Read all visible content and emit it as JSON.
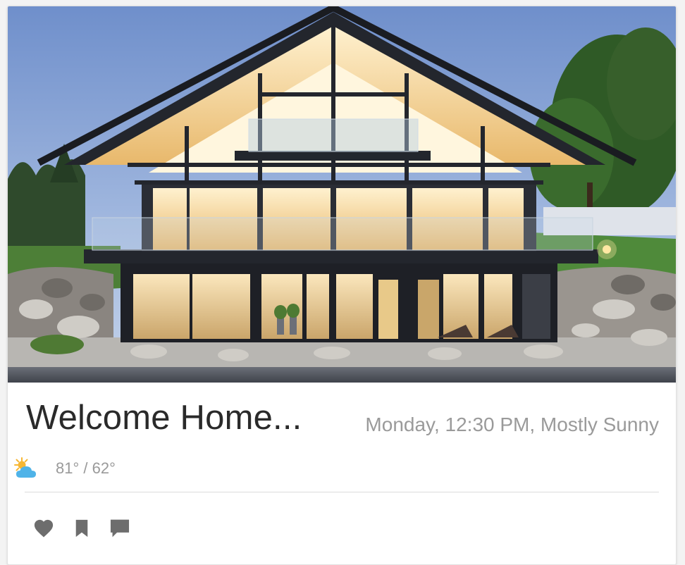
{
  "card": {
    "image_alt": "Modern glass house at dusk",
    "title": "Welcome Home...",
    "subtitle": "Monday, 12:30 PM, Mostly Sunny",
    "weather": {
      "icon": "partly-sunny-icon",
      "temps": "81° / 62°"
    },
    "actions": [
      {
        "name": "like",
        "icon": "heart-icon"
      },
      {
        "name": "bookmark",
        "icon": "bookmark-icon"
      },
      {
        "name": "comment",
        "icon": "comment-icon"
      }
    ]
  },
  "colors": {
    "title": "#2a2a2a",
    "muted": "#9a9a9a",
    "icon": "#6d6d6d",
    "sun": "#f7b733",
    "cloud": "#4fb3e8"
  }
}
